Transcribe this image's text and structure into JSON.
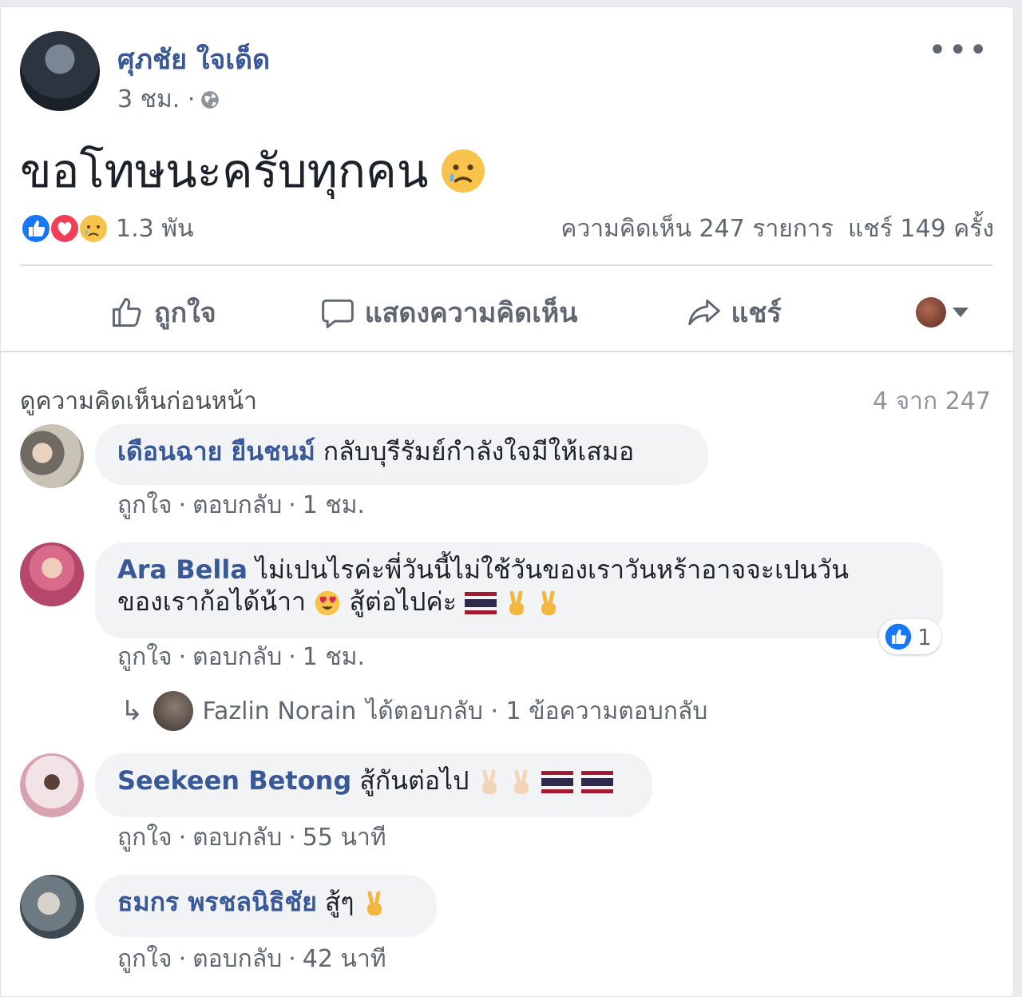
{
  "post": {
    "author_name": "ศุภชัย ใจเด็ด",
    "time": "3 ชม. ·",
    "text": "ขอโทษนะครับทุกคน",
    "reactions_count": "1.3 พัน",
    "comments_count": "ความคิดเห็น 247 รายการ",
    "shares_count": "แชร์ 149 ครั้ง"
  },
  "actions": {
    "like": "ถูกใจ",
    "comment": "แสดงความคิดเห็น",
    "share": "แชร์"
  },
  "comments_header": {
    "view_previous": "ดูความคิดเห็นก่อนหน้า",
    "count": "4 จาก 247"
  },
  "comments": [
    {
      "name": "เดือนฉาย ยืนชนม์",
      "text": "กลับบุรีรัมย์กำลังใจมีให้เสมอ",
      "like": "ถูกใจ",
      "reply": "ตอบกลับ",
      "time": "1 ชม."
    },
    {
      "name": "Ara Bella",
      "text_line1": "ไม่เปนไรค่ะพี่วันนี้ไม่ใช้วันของเราวันหร้าอาจจะเปนวัน",
      "text_line2": "ของเราก้อได้น้าา",
      "text_line2b": "สู้ต่อไปค่ะ",
      "like": "ถูกใจ",
      "reply": "ตอบกลับ",
      "time": "1 ชม.",
      "like_count": "1",
      "reply_summary": {
        "name": "Fazlin Norain",
        "text": "ได้ตอบกลับ · 1 ข้อความตอบกลับ"
      }
    },
    {
      "name": "Seekeen Betong",
      "text": "สู้กันต่อไป",
      "like": "ถูกใจ",
      "reply": "ตอบกลับ",
      "time": "55 นาที"
    },
    {
      "name": "ธมกร พรชลนิธิชัย",
      "text": "สู้ๆ",
      "like": "ถูกใจ",
      "reply": "ตอบกลับ",
      "time": "42 นาที"
    }
  ],
  "colors": {
    "link": "#385898",
    "secondary_text": "#606770",
    "bubble": "#f2f3f5",
    "like_blue": "#1877f2",
    "love_red": "#f33e58"
  }
}
